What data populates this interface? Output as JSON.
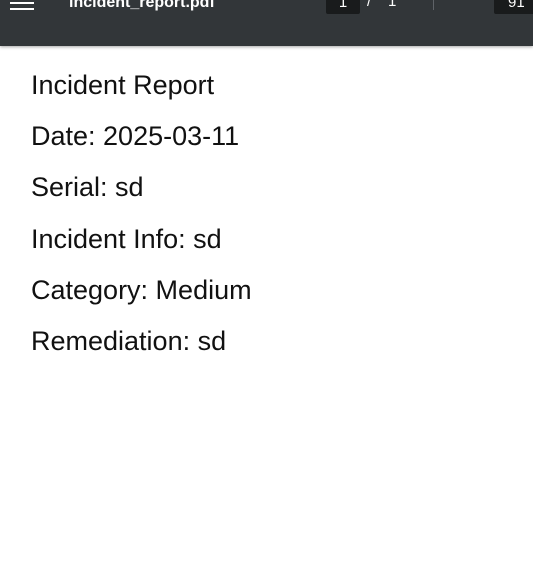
{
  "toolbar": {
    "menu_icon": "menu-icon",
    "file_title": "incident_report.pdf",
    "page_current": "1",
    "page_separator": "/",
    "page_total": "1",
    "zoom_out_icon": "minus-icon",
    "zoom_value": "91"
  },
  "document": {
    "lines": [
      "Incident Report",
      "Date: 2025-03-11",
      "Serial: sd",
      "Incident Info: sd",
      "Category: Medium",
      "Remediation: sd"
    ]
  },
  "colors": {
    "toolbar_bg": "#323639",
    "input_bg": "#191b1c",
    "page_bg": "#ffffff",
    "text": "#111111"
  }
}
